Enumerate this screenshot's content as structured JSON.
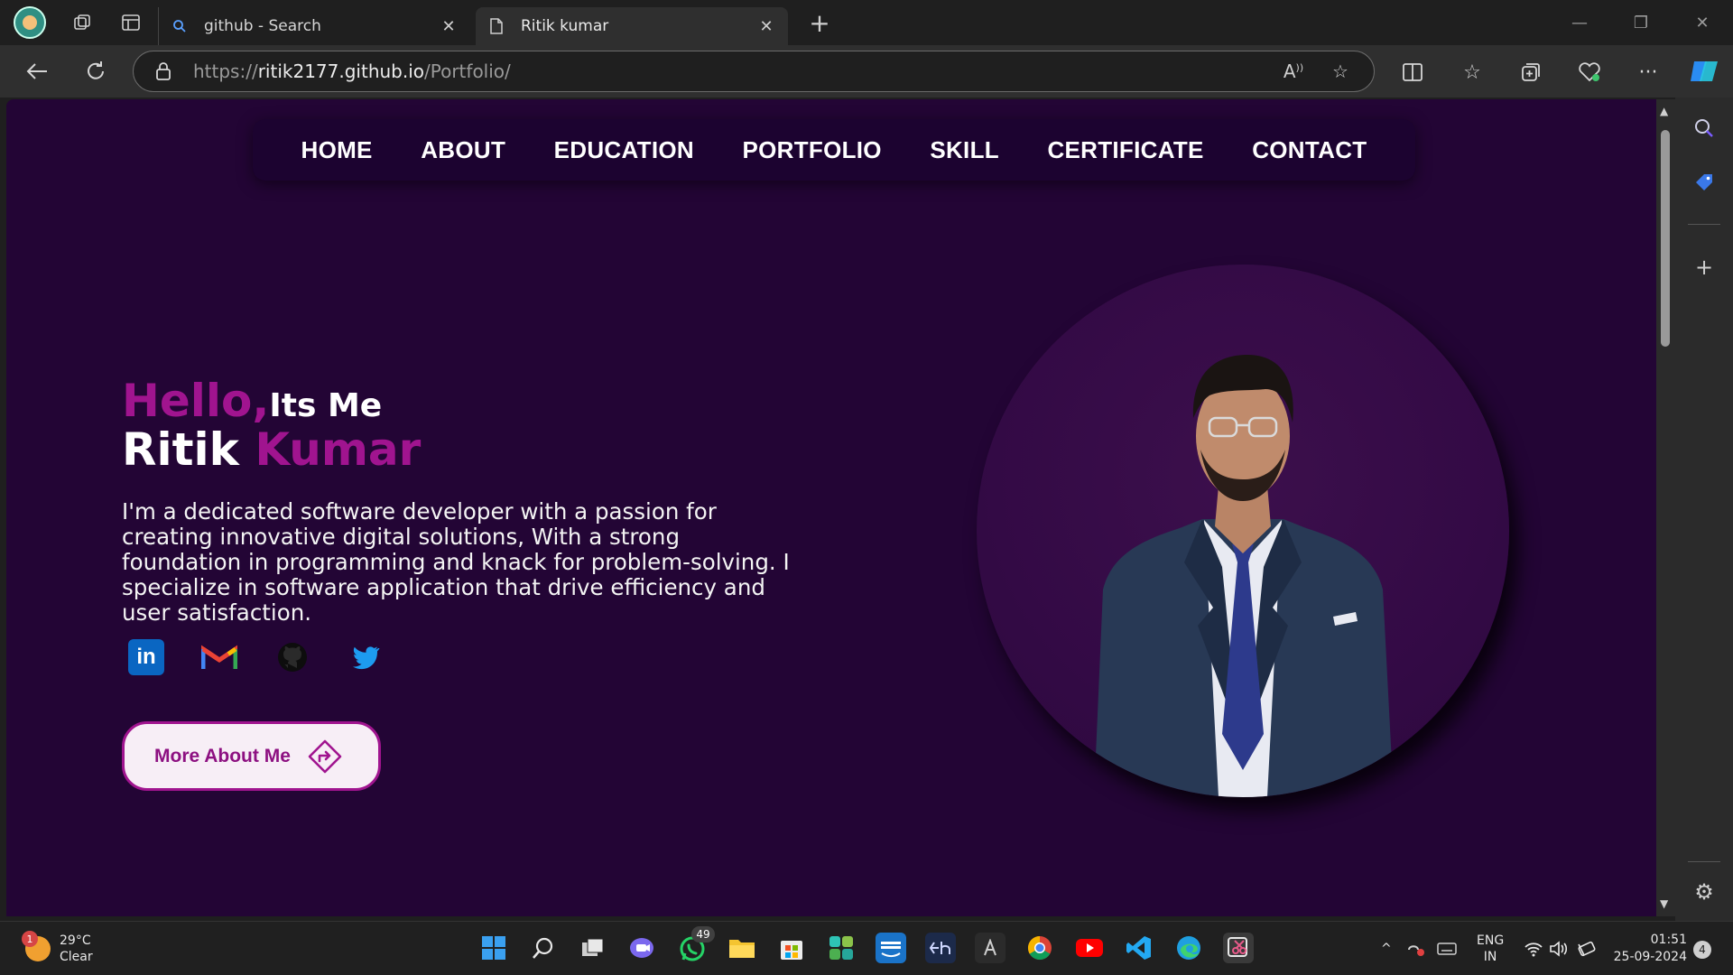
{
  "browser": {
    "tabs": [
      {
        "title": "github - Search",
        "favicon": "search-icon"
      },
      {
        "title": "Ritik kumar",
        "favicon": "page-icon"
      }
    ],
    "url": {
      "scheme": "https://",
      "host": "ritik2177.github.io",
      "path": "/Portfolio/"
    },
    "new_tab_label": "+"
  },
  "page": {
    "nav": [
      "HOME",
      "ABOUT",
      "EDUCATION",
      "PORTFOLIO",
      "SKILL",
      "CERTIFICATE",
      "CONTACT"
    ],
    "hello": "Hello,",
    "its_me": "Its Me",
    "first_name": "Ritik",
    "last_name": "Kumar",
    "description": "I'm a dedicated software developer with a passion for creating innovative digital solutions, With a strong foundation in programming and knack for problem-solving. I specialize in software application that drive efficiency and user satisfaction.",
    "socials": [
      "linkedin-icon",
      "gmail-icon",
      "github-icon",
      "twitter-icon"
    ],
    "linkedin_label": "in",
    "more_button": "More About Me",
    "colors": {
      "accent": "#a0148f",
      "background": "#230535",
      "navbar": "#1c0330"
    }
  },
  "taskbar": {
    "weather_temp": "29°C",
    "weather_desc": "Clear",
    "weather_badge": "1",
    "whatsapp_badge": "49",
    "lang_top": "ENG",
    "lang_bottom": "IN",
    "time": "01:51",
    "date": "25-09-2024",
    "notifications": "4"
  }
}
